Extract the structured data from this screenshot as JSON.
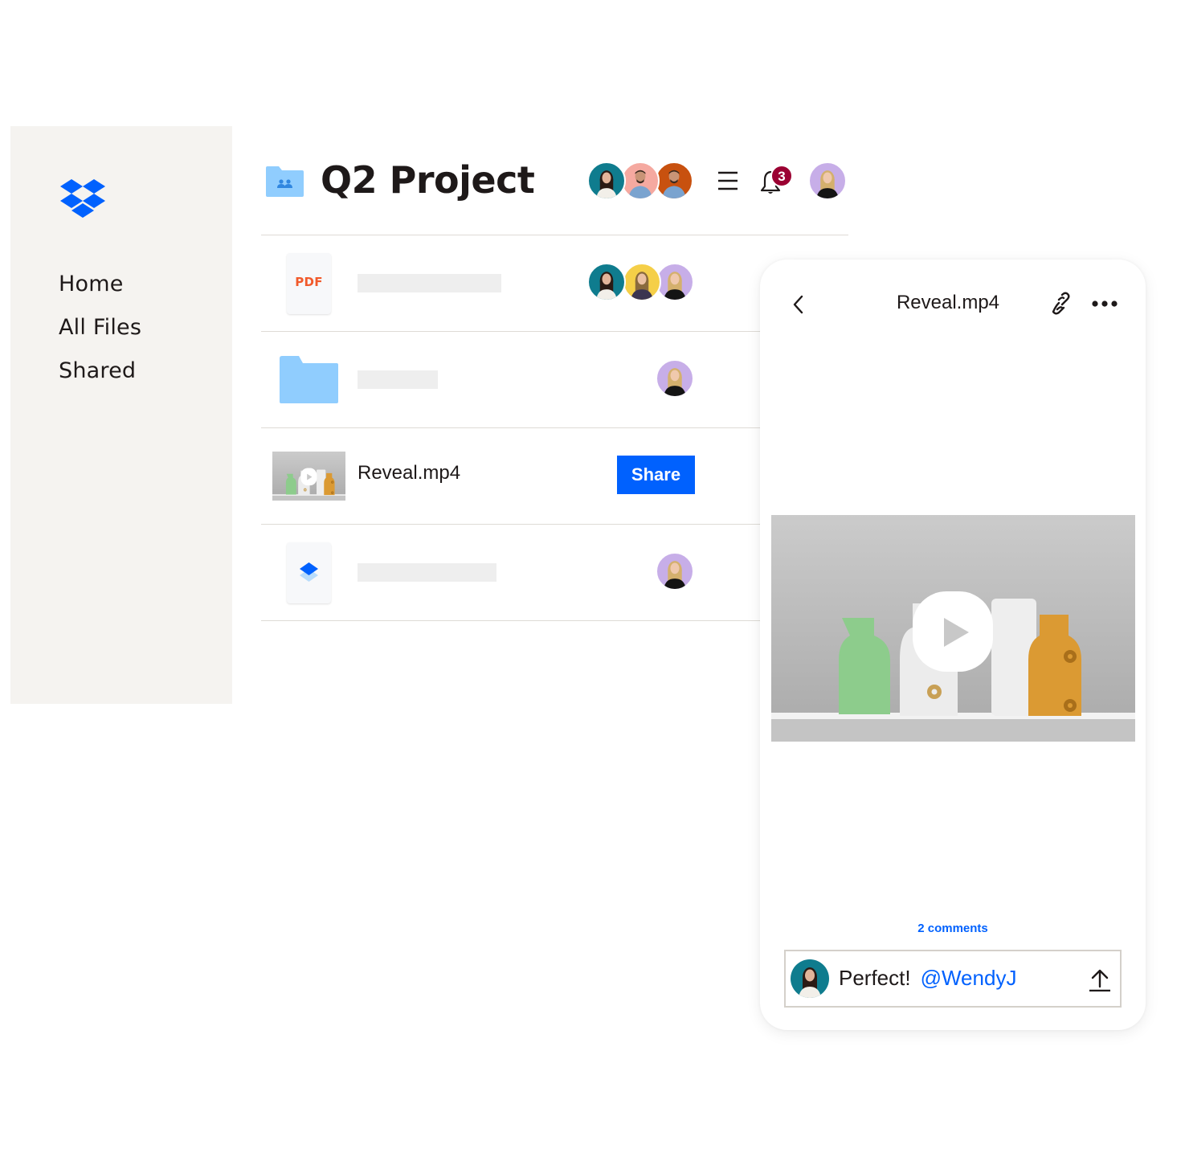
{
  "sidebar": {
    "logo": "dropbox-logo",
    "items": [
      {
        "label": "Home"
      },
      {
        "label": "All Files"
      },
      {
        "label": "Shared"
      }
    ]
  },
  "header": {
    "folder_icon": "shared-folder-icon",
    "title": "Q2 Project",
    "members": [
      "teal-avatar-woman",
      "pink-avatar-man",
      "orange-avatar-man"
    ],
    "menu_icon": "hamburger-menu-icon",
    "notifications_count": "3",
    "current_user": "purple-avatar-woman"
  },
  "files": [
    {
      "type": "pdf",
      "type_label": "PDF",
      "name": "",
      "shared_with": [
        "teal",
        "yellow",
        "purple"
      ]
    },
    {
      "type": "folder",
      "name": "",
      "shared_with": [
        "purple"
      ]
    },
    {
      "type": "video",
      "name": "Reveal.mp4",
      "action_label": "Share"
    },
    {
      "type": "dropbox-doc",
      "name": "",
      "shared_with": [
        "purple"
      ]
    }
  ],
  "preview": {
    "title": "Reveal.mp4",
    "back_icon": "chevron-left-icon",
    "link_icon": "link-icon",
    "more_icon": "more-horizontal-icon",
    "comments_label": "2 comments",
    "comment": {
      "text": "Perfect!",
      "mention": "@WendyJ"
    }
  },
  "colors": {
    "accent": "#0061fe",
    "sidebar_bg": "#f5f3f0",
    "badge": "#9b0032",
    "pdf": "#f15a2b",
    "folder": "#90cdfe"
  }
}
